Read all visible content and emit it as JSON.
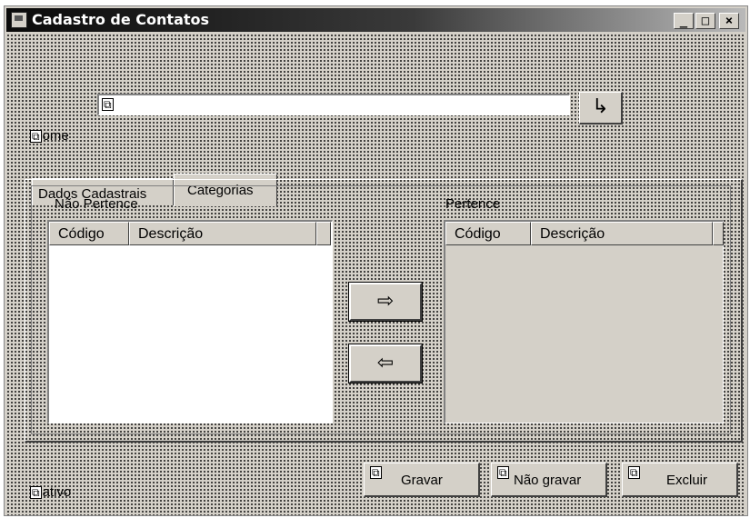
{
  "window": {
    "title": "Cadastro de Contatos"
  },
  "caption_buttons": {
    "minimize": "_",
    "maximize": "□",
    "close": "×"
  },
  "form": {
    "nome_label": "ome",
    "nome_value": "",
    "lookup_glyph": "↳"
  },
  "tabs": [
    {
      "label": "Dados Cadastrais",
      "selected": false
    },
    {
      "label": "Categorias",
      "selected": true
    }
  ],
  "lists": {
    "nao_pertence": {
      "label": "Não Pertence",
      "columns": [
        "Código",
        "Descrição"
      ],
      "rows": []
    },
    "pertence": {
      "label": "Pertence",
      "columns": [
        "Código",
        "Descrição"
      ],
      "rows": []
    }
  },
  "move_buttons": {
    "add": "⇨",
    "remove": "⇦"
  },
  "bottom": {
    "ativo_label": "ativo",
    "gravar": "Gravar",
    "nao_gravar": "Não gravar",
    "excluir": "Excluir"
  },
  "colors": {
    "face": "#d4d0c8",
    "titlebar_start": "#0a0a0a",
    "titlebar_end": "#b9b9b9",
    "list_disabled": "#d4d0c8"
  }
}
